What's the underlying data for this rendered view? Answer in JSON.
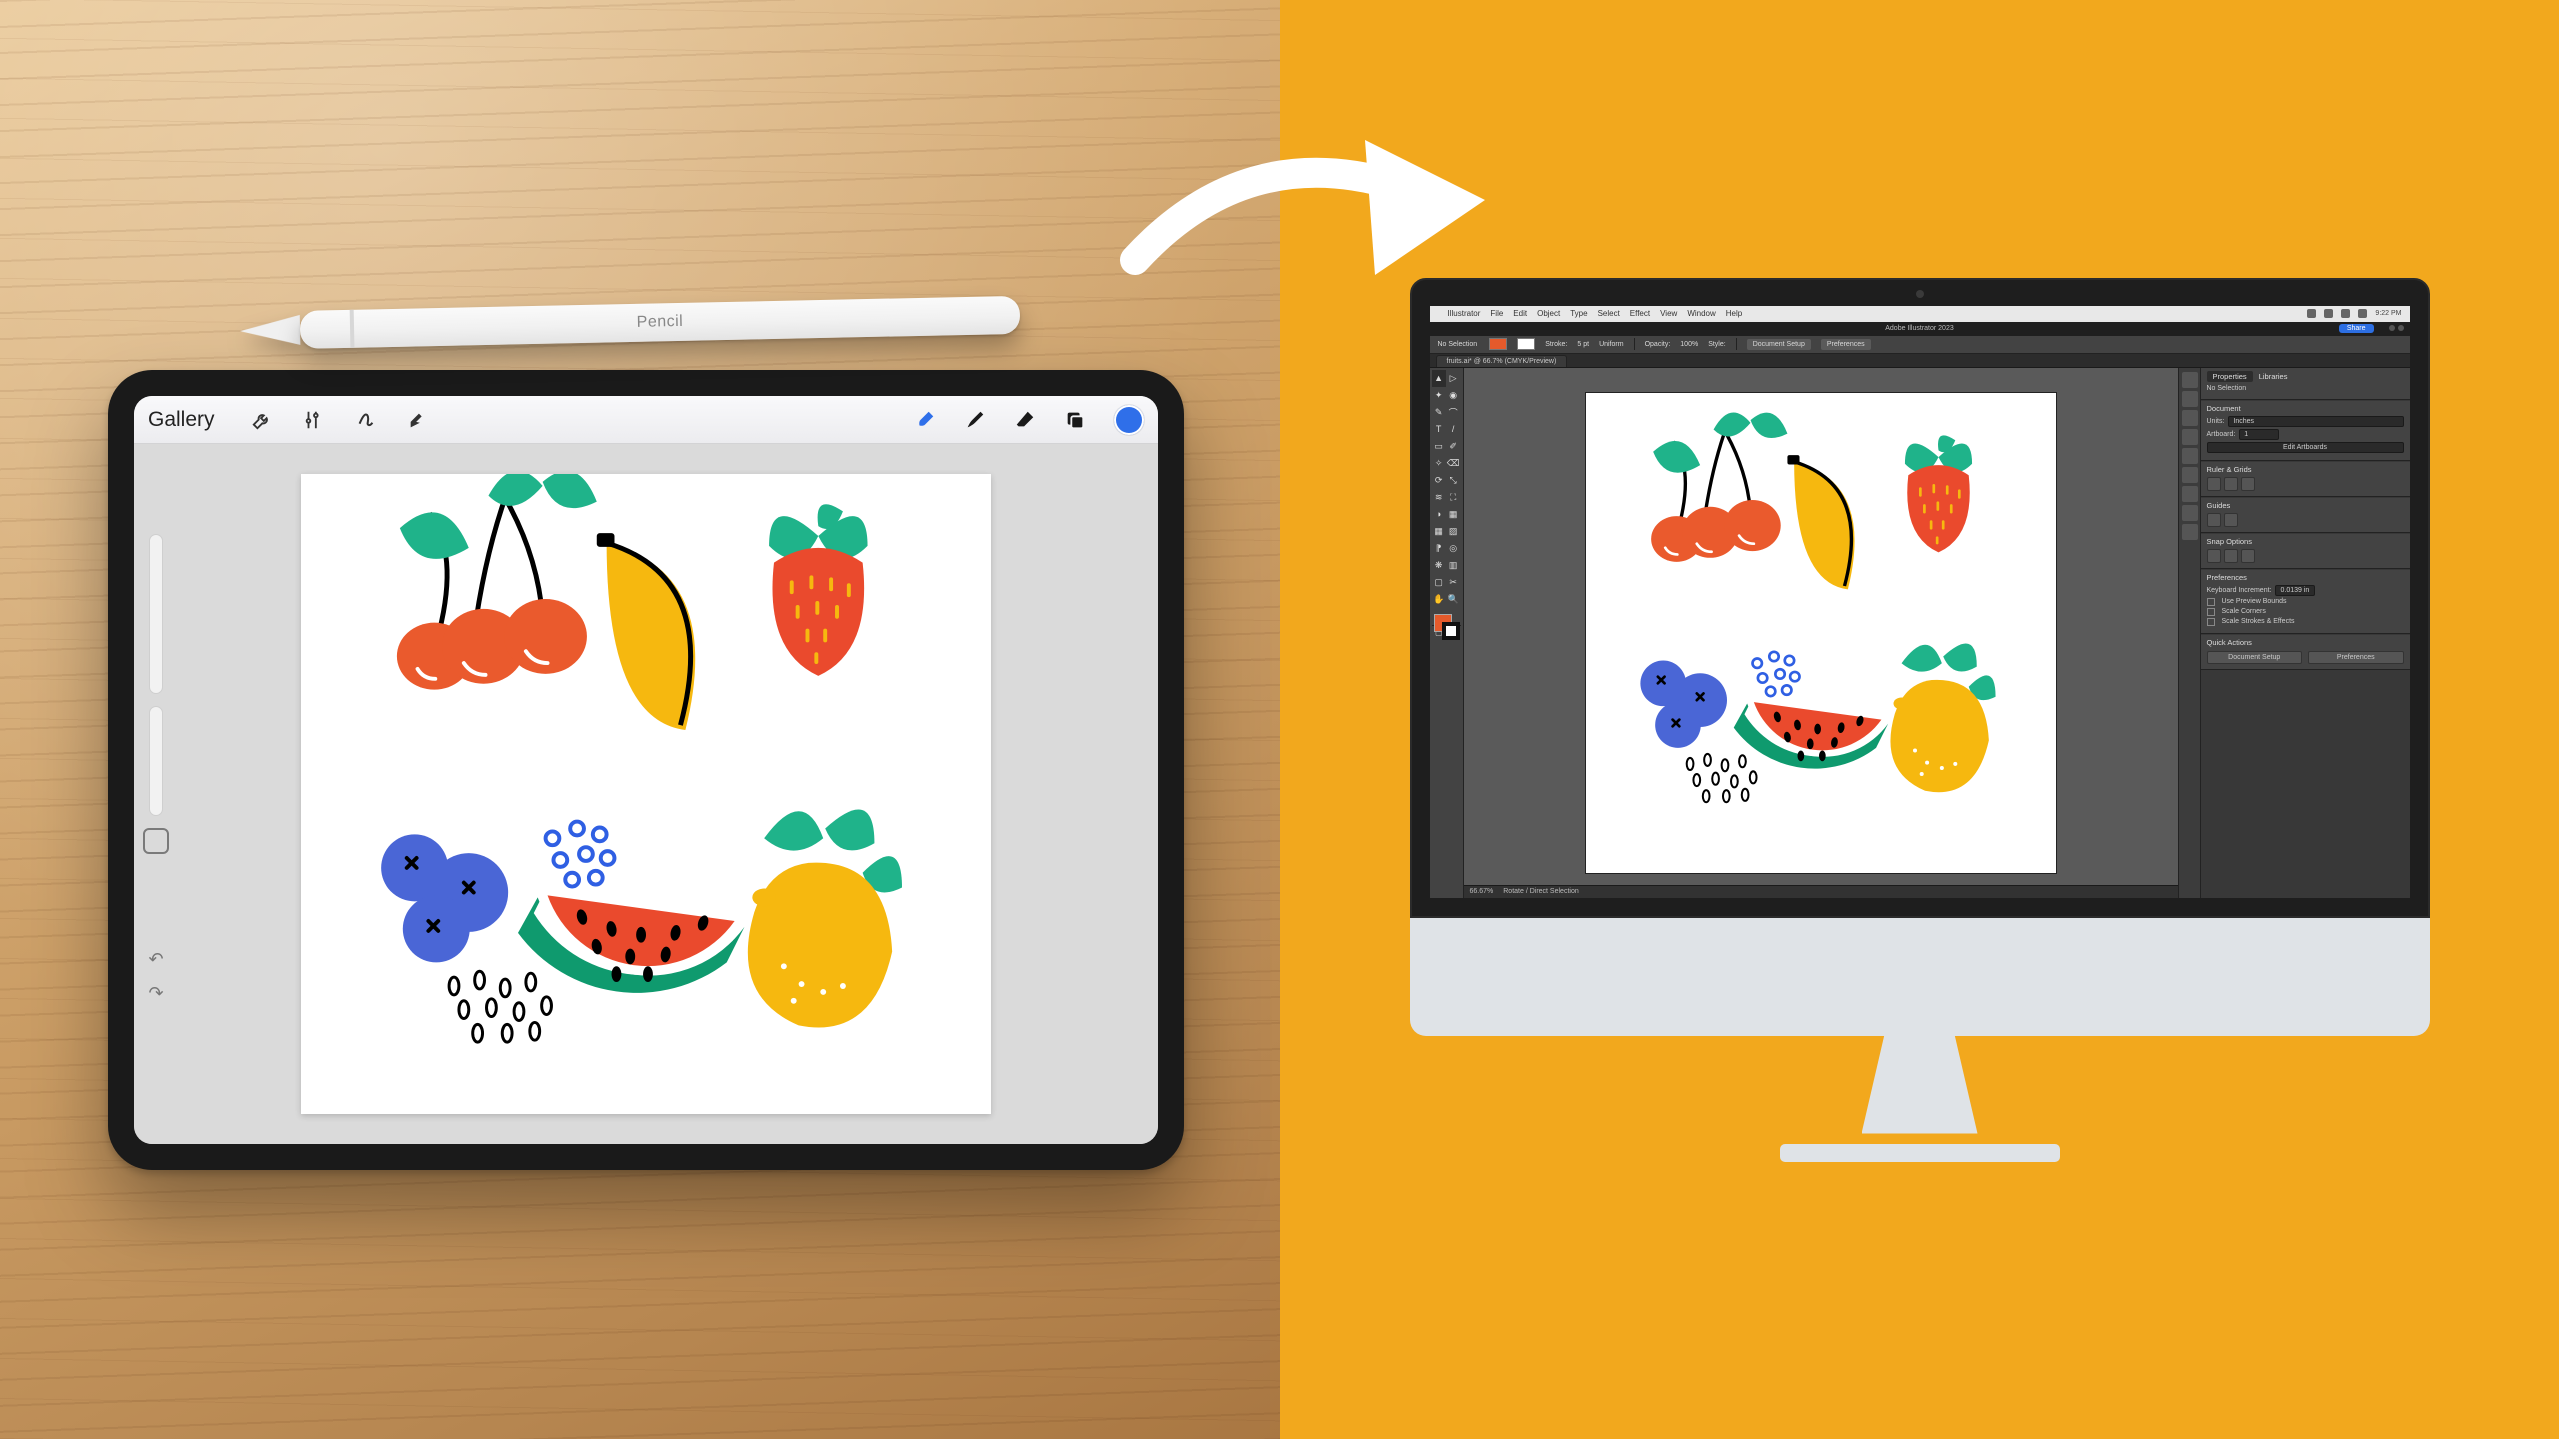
{
  "arrow": {
    "color": "#ffffff"
  },
  "pencil": {
    "brand": " Pencil"
  },
  "procreate": {
    "gallery_label": "Gallery",
    "tool_icons": [
      "wrench",
      "wand",
      "s-curve",
      "arrow-pointer"
    ],
    "right_icons": [
      "paintbrush-blue",
      "smudge",
      "eraser",
      "layers"
    ],
    "active_color": "#2f6fe9"
  },
  "illustrator": {
    "mac_menu": [
      "Illustrator",
      "File",
      "Edit",
      "Object",
      "Type",
      "Select",
      "Effect",
      "View",
      "Window",
      "Help"
    ],
    "mac_status_time": "9:22 PM",
    "app_title": "Adobe Illustrator 2023",
    "share_label": "Share",
    "document_tab": "fruits.ai* @ 66.7% (CMYK/Preview)",
    "optionsbar": {
      "no_selection": "No Selection",
      "stroke_label": "Stroke:",
      "stroke_pt": "5 pt",
      "uniform": "Uniform",
      "opacity_label": "Opacity:",
      "opacity_val": "100%",
      "style_label": "Style:",
      "doc_setup": "Document Setup",
      "preferences": "Preferences"
    },
    "status": {
      "zoom": "66.67%",
      "tool": "Rotate / Direct Selection"
    },
    "panels": {
      "properties_tab": "Properties",
      "libraries_tab": "Libraries",
      "no_selection": "No Selection",
      "document_hdr": "Document",
      "units_label": "Units:",
      "units_value": "Inches",
      "artboard_label": "Artboard:",
      "artboard_value": "1",
      "edit_artboards": "Edit Artboards",
      "ruler_grid_hdr": "Ruler & Grids",
      "guides_hdr": "Guides",
      "snap_hdr": "Snap Options",
      "preferences_hdr": "Preferences",
      "keyboard_inc": "Keyboard Increment:",
      "keyboard_inc_val": "0.0139 in",
      "use_preview": "Use Preview Bounds",
      "scale_corners": "Scale Corners",
      "scale_strokes": "Scale Strokes & Effects",
      "quick_hdr": "Quick Actions",
      "btn_doc_setup": "Document Setup",
      "btn_prefs": "Preferences"
    }
  }
}
